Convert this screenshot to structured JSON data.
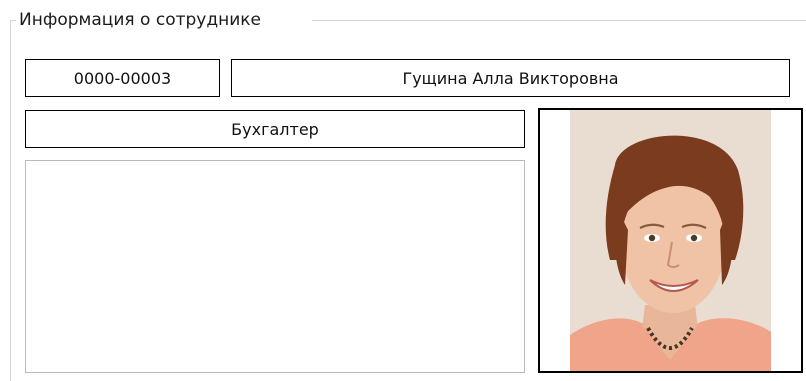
{
  "employee_info": {
    "group_title": "Информация о сотруднике",
    "code": "0000-00003",
    "full_name": "Гущина Алла Викторовна",
    "position": "Бухгалтер",
    "notes": ""
  },
  "photo": {
    "icon": "employee-photo"
  }
}
